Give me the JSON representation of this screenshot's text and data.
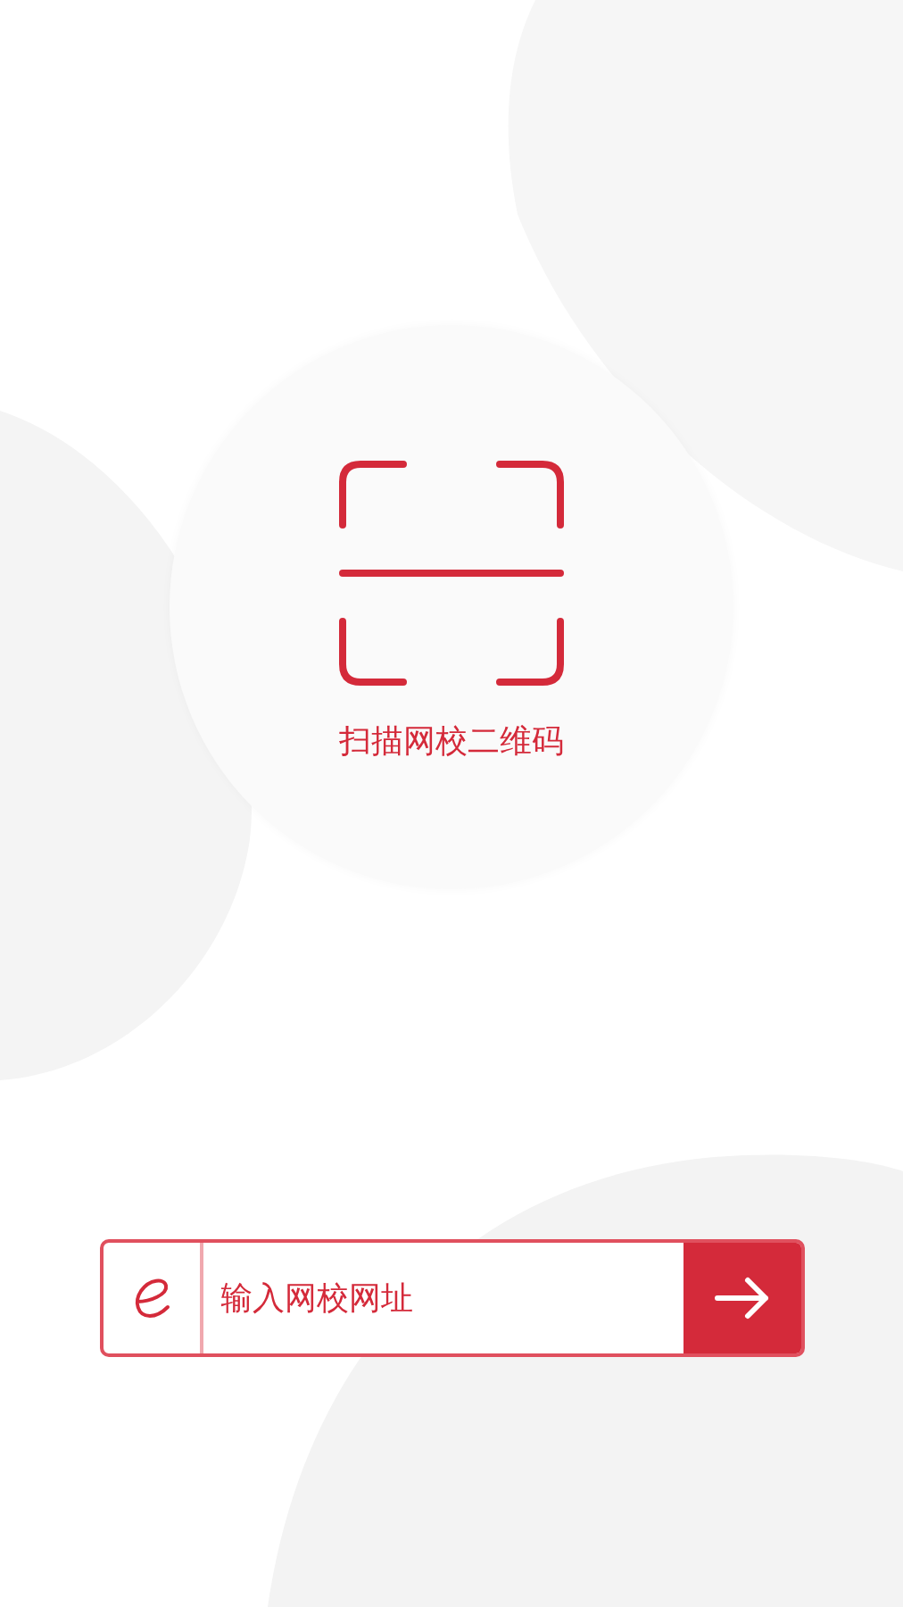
{
  "scan": {
    "label": "扫描网校二维码"
  },
  "url_input": {
    "placeholder": "输入网校网址"
  }
}
